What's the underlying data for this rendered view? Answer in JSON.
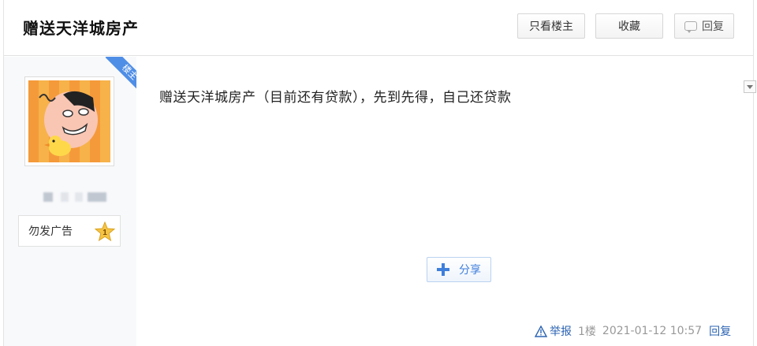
{
  "thread": {
    "title": "赠送天洋城房产"
  },
  "header_actions": {
    "only_op_label": "只看楼主",
    "collect_label": "收藏",
    "reply_label": "回复"
  },
  "author": {
    "op_tag": "楼主",
    "badge_label": "勿发广告",
    "level": "1"
  },
  "post": {
    "content": "赠送天洋城房产（目前还有贷款），先到先得，自己还贷款",
    "share_label": "分享",
    "report_label": "举报",
    "floor": "1楼",
    "time": "2021-01-12 10:57",
    "reply_label": "回复"
  },
  "colors": {
    "link_blue": "#2d64b3",
    "share_blue": "#3f7fdc",
    "ribbon_blue": "#4f8ee6",
    "star_yellow": "#f6c445"
  }
}
